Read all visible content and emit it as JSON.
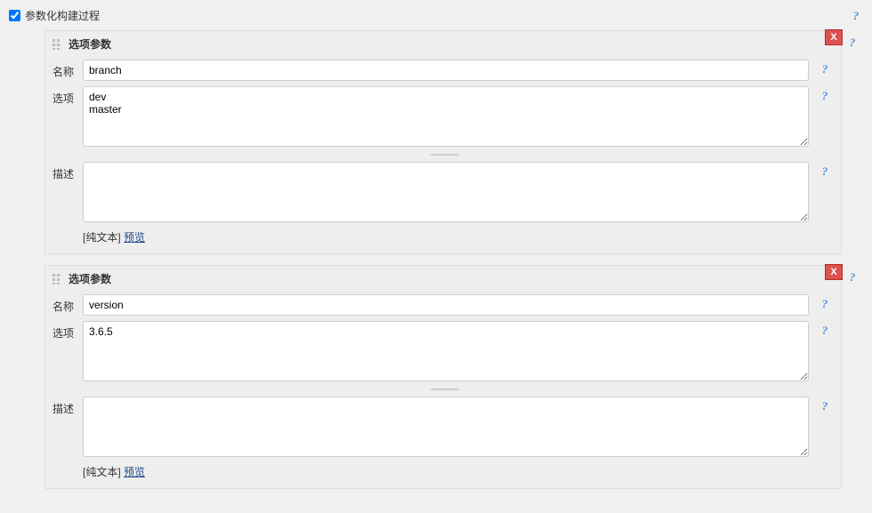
{
  "header": {
    "checkbox_label": "参数化构建过程",
    "checked": true
  },
  "labels": {
    "name": "名称",
    "options": "选项",
    "description": "描述",
    "plaintext_prefix": "[纯文本] ",
    "preview_link": "预览"
  },
  "parameters": [
    {
      "title": "选项参数",
      "name_value": "branch",
      "options_value": "dev\nmaster",
      "description_value": ""
    },
    {
      "title": "选项参数",
      "name_value": "version",
      "options_value": "3.6.5",
      "description_value": ""
    }
  ]
}
